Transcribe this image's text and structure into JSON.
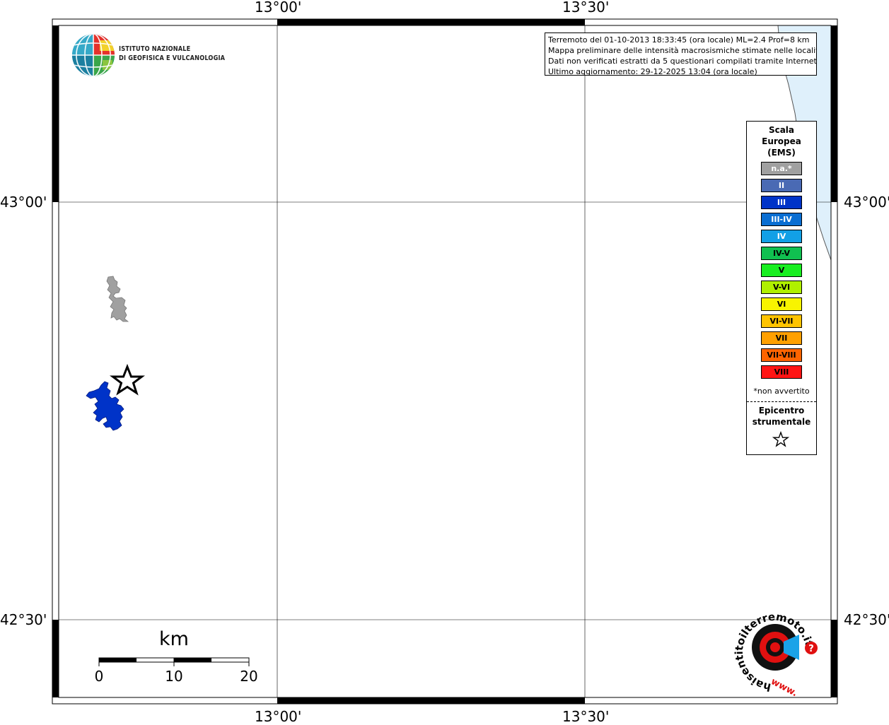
{
  "map": {
    "lon_labels": [
      "13°00'",
      "13°30'"
    ],
    "lat_labels": [
      "43°00'",
      "42°30'"
    ],
    "sea_color": "#dff0fb",
    "coast_color": "#555555"
  },
  "institute": {
    "line1": "ISTITUTO NAZIONALE",
    "line2": "DI GEOFISICA E VULCANOLOGIA"
  },
  "info": {
    "line1": "Terremoto del 01-10-2013 18:33:45 (ora locale) ML=2.4 Prof=8 km",
    "line2": "Mappa preliminare delle intensità macrosismiche stimate nelle località",
    "line3": "Dati non verificati estratti da 5 questionari compilati tramite Internet.",
    "line4": "Ultimo aggiornamento: 29-12-2025 13:04 (ora locale)"
  },
  "legend": {
    "title1": "Scala",
    "title2": "Europea",
    "title3": "(EMS)",
    "items": [
      {
        "label": "n.a.*",
        "color": "#a0a0a0",
        "text_color": "#ffffff"
      },
      {
        "label": "II",
        "color": "#4a6ab4",
        "text_color": "#ffffff"
      },
      {
        "label": "III",
        "color": "#0033c8",
        "text_color": "#ffffff"
      },
      {
        "label": "III-IV",
        "color": "#0a6ed2",
        "text_color": "#ffffff"
      },
      {
        "label": "IV",
        "color": "#12a0e6",
        "text_color": "#ffffff"
      },
      {
        "label": "IV-V",
        "color": "#10c050",
        "text_color": "#000000"
      },
      {
        "label": "V",
        "color": "#18ee20",
        "text_color": "#000000"
      },
      {
        "label": "V-VI",
        "color": "#b0f000",
        "text_color": "#000000"
      },
      {
        "label": "VI",
        "color": "#f8f400",
        "text_color": "#000000"
      },
      {
        "label": "VI-VII",
        "color": "#ffc400",
        "text_color": "#000000"
      },
      {
        "label": "VII",
        "color": "#ffa000",
        "text_color": "#000000"
      },
      {
        "label": "VII-VIII",
        "color": "#ff6400",
        "text_color": "#000000"
      },
      {
        "label": "VIII",
        "color": "#ff1414",
        "text_color": "#000000"
      }
    ],
    "note": "*non avvertito",
    "epicenter1": "Epicentro",
    "epicenter2": "strumentale"
  },
  "municipalities": [
    {
      "name": "na-municipality",
      "intensity": "n.a.*",
      "color": "#a0a0a0"
    },
    {
      "name": "iii-municipality",
      "intensity": "III",
      "color": "#0033c8"
    }
  ],
  "scalebar": {
    "unit": "km",
    "ticks": [
      "0",
      "10",
      "20"
    ]
  },
  "hsit_logo": {
    "ring_text": "haisentitoilterremoto.it",
    "bottom_text": "www.",
    "red_color": "#e01010"
  }
}
